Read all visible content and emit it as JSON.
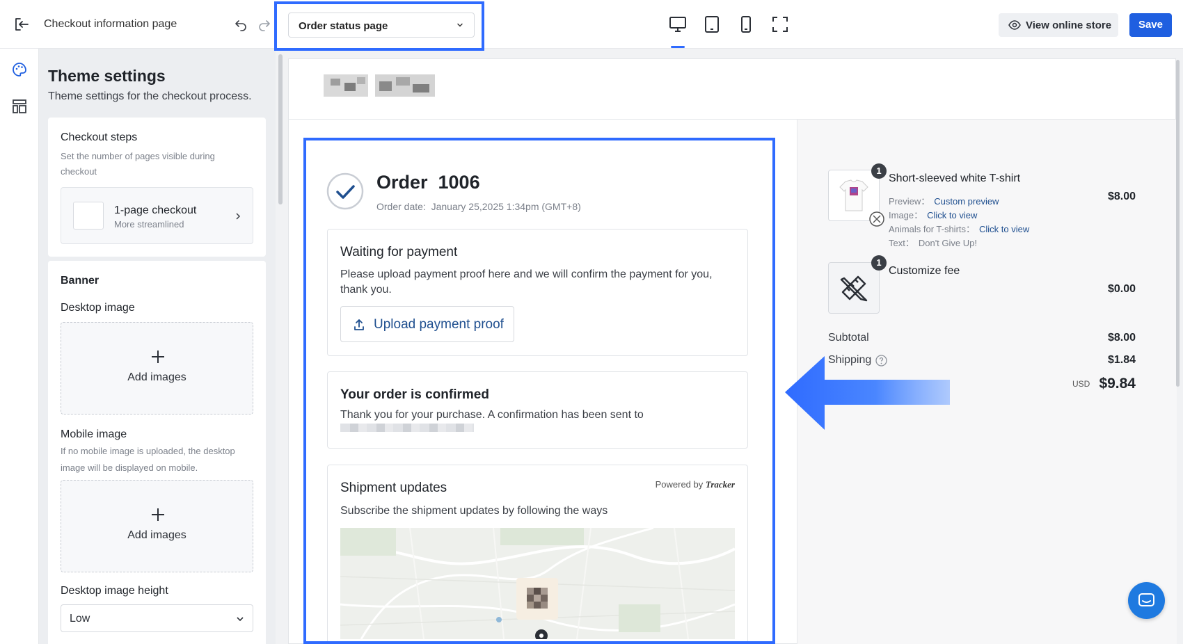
{
  "topbar": {
    "page_title": "Checkout information page",
    "page_select": "Order status page",
    "view_store": "View online store",
    "save": "Save"
  },
  "panel": {
    "title": "Theme settings",
    "subtitle": "Theme settings for the checkout process.",
    "checkout_steps": {
      "title": "Checkout steps",
      "desc": "Set the number of pages visible during checkout",
      "option_label": "1-page checkout",
      "option_sub": "More streamlined"
    },
    "banner": {
      "title": "Banner",
      "desktop_label": "Desktop image",
      "desktop_add": "Add images",
      "mobile_label": "Mobile image",
      "mobile_desc": "If no mobile image is uploaded, the desktop image will be displayed on mobile.",
      "mobile_add": "Add images",
      "height_label": "Desktop image height",
      "height_value": "Low"
    }
  },
  "order": {
    "title": "Order  1006",
    "date": "Order date:  January 25,2025 1:34pm (GMT+8)",
    "waiting": {
      "title": "Waiting for payment",
      "text": "Please upload payment proof here and we will confirm the payment for you, thank you.",
      "button": "Upload payment proof"
    },
    "confirmed": {
      "title": "Your order is confirmed",
      "text": "Thank you for your purchase. A confirmation has been sent to"
    },
    "shipment": {
      "title": "Shipment updates",
      "powered_prefix": "Powered by",
      "powered_brand": "Tracker",
      "text": "Subscribe the shipment updates by following the ways"
    }
  },
  "summary": {
    "items": [
      {
        "qty": "1",
        "name": "Short-sleeved white T-shirt",
        "price": "$8.00",
        "props": [
          {
            "label": "Preview：",
            "value": "Custom preview",
            "link": true
          },
          {
            "label": "Image：",
            "value": "Click to view",
            "link": true
          },
          {
            "label": "Animals for T-shirts：",
            "value": "Click to view",
            "link": true
          },
          {
            "label": "Text：",
            "value": "Don't Give Up!",
            "link": false
          }
        ]
      },
      {
        "qty": "1",
        "name": "Customize fee",
        "price": "$0.00"
      }
    ],
    "subtotal_label": "Subtotal",
    "subtotal": "$8.00",
    "shipping_label": "Shipping",
    "shipping": "$1.84",
    "currency": "USD",
    "total": "$9.84"
  },
  "colors": {
    "accent": "#1f5fe0",
    "highlight": "#2f6bff",
    "link": "#1f4f8f"
  }
}
